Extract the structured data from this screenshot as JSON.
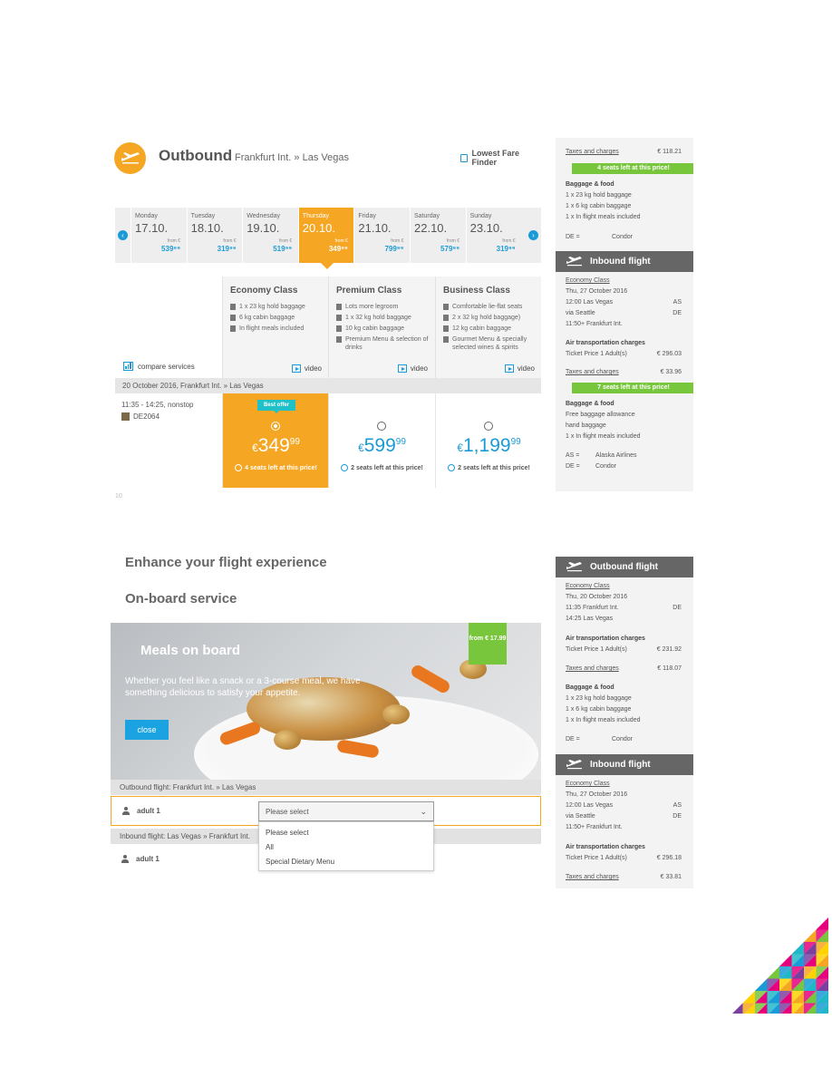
{
  "outbound": {
    "title": "Outbound",
    "route": "Frankfurt Int. » Las Vegas",
    "lowest_fare_finder": "Lowest Fare Finder",
    "days": [
      {
        "name": "Monday",
        "date": "17.10.",
        "from": "from €",
        "price": "539⁹⁹",
        "selected": false
      },
      {
        "name": "Tuesday",
        "date": "18.10.",
        "from": "from €",
        "price": "319⁹⁹",
        "selected": false
      },
      {
        "name": "Wednesday",
        "date": "19.10.",
        "from": "from €",
        "price": "519⁹⁹",
        "selected": false
      },
      {
        "name": "Thursday",
        "date": "20.10.",
        "from": "from €",
        "price": "349⁹⁹",
        "selected": true
      },
      {
        "name": "Friday",
        "date": "21.10.",
        "from": "from €",
        "price": "799⁹⁹",
        "selected": false
      },
      {
        "name": "Saturday",
        "date": "22.10.",
        "from": "from €",
        "price": "579⁹⁹",
        "selected": false
      },
      {
        "name": "Sunday",
        "date": "23.10.",
        "from": "from €",
        "price": "319⁹⁹",
        "selected": false
      }
    ],
    "classes": [
      {
        "title": "Economy Class",
        "features": [
          "1 x 23 kg hold baggage",
          "6 kg cabin baggage",
          "In flight meals included"
        ],
        "video": "video"
      },
      {
        "title": "Premium Class",
        "features": [
          "Lots more legroom",
          "1 x 32 kg hold baggage",
          "10 kg cabin baggage",
          "Premium Menu & selection of drinks"
        ],
        "video": "video"
      },
      {
        "title": "Business Class",
        "features": [
          "Comfortable lie-flat seats",
          "2 x 32 kg hold baggage)",
          "12 kg cabin baggage",
          "Gourmet Menu & specially selected wines & spirits"
        ],
        "video": "video"
      }
    ],
    "compare_services": "compare services",
    "route_bar": "20 October 2016, Frankfurt Int. » Las Vegas",
    "flight_time": "11:35 - 14:25, nonstop",
    "flight_no": "DE2064",
    "best_offer": "Best offer",
    "fares": [
      {
        "currency": "€",
        "main": "349",
        "cents": "99",
        "seats": "4 seats left at this price!",
        "best": true
      },
      {
        "currency": "€",
        "main": "599",
        "cents": "99",
        "seats": "2 seats left at this price!",
        "best": false
      },
      {
        "currency": "€",
        "main": "1,199",
        "cents": "99",
        "seats": "2 seats left at this price!",
        "best": false
      }
    ],
    "page_number": "10"
  },
  "sidebar_top": {
    "taxes_label": "Taxes and charges",
    "taxes_value": "€ 118.21",
    "seats_band1": "4 seats left at this price!",
    "baggage_title": "Baggage & food",
    "baggage_items": [
      "1 x 23 kg hold baggage",
      "1 x 6 kg cabin baggage",
      "1 x In flight meals included"
    ],
    "carrier_code": "DE =",
    "carrier_name": "Condor",
    "inbound_title": "Inbound flight",
    "class": "Economy Class",
    "date": "Thu, 27 October 2016",
    "dep": "12:00 Las Vegas",
    "dep_code": "AS",
    "via": "via Seattle",
    "via_code": "DE",
    "arr": "11:50+ Frankfurt Int.",
    "air_charges_title": "Air transportation charges",
    "ticket_label": "Ticket Price 1 Adult(s)",
    "ticket_value": "€ 296.03",
    "taxes2_label": "Taxes and charges",
    "taxes2_value": "€ 33.96",
    "seats_band2": "7 seats left at this price!",
    "baggage2_title": "Baggage & food",
    "baggage2_items": [
      "Free baggage allowance",
      "hand baggage",
      "1 x In flight meals included"
    ],
    "carrier2_code": "AS =",
    "carrier2_name": "Alaska Airlines",
    "carrier3_code": "DE =",
    "carrier3_name": "Condor"
  },
  "enhance": {
    "title": "Enhance your flight experience",
    "subtitle": "On-board service",
    "meal_title": "Meals on board",
    "meal_desc": "Whether you feel like a snack or a 3-course meal, we have something delicious to satisfy your appetite.",
    "close": "close",
    "from_price": "from € 17.99",
    "outbound_label": "Outbound flight: Frankfurt Int. » Las Vegas",
    "inbound_label": "Inbound flight: Las Vegas » Frankfurt Int.",
    "pax1": "adult 1",
    "pax2": "adult 1",
    "select_value": "Please select",
    "options": [
      "Please select",
      "All",
      "Special Dietary Menu"
    ]
  },
  "sidebar_bottom": {
    "outbound_title": "Outbound flight",
    "class": "Economy Class",
    "date": "Thu, 20 October 2016",
    "dep": "11:35 Frankfurt Int.",
    "dep_code": "DE",
    "arr": "14:25 Las Vegas",
    "air_charges_title": "Air transportation charges",
    "ticket_label": "Ticket Price 1 Adult(s)",
    "ticket_value": "€ 231.92",
    "taxes_label": "Taxes and charges",
    "taxes_value": "€ 118.07",
    "baggage_title": "Baggage & food",
    "baggage_items": [
      "1 x 23 kg hold baggage",
      "1 x 6 kg cabin baggage",
      "1 x In flight meals included"
    ],
    "carrier_code": "DE =",
    "carrier_name": "Condor",
    "inbound_title": "Inbound flight",
    "in_class": "Economy Class",
    "in_date": "Thu, 27 October 2016",
    "in_dep": "12:00 Las Vegas",
    "in_dep_code": "AS",
    "in_via": "via Seattle",
    "in_via_code": "DE",
    "in_arr": "11:50+ Frankfurt Int.",
    "in_air_charges_title": "Air transportation charges",
    "in_ticket_label": "Ticket Price 1 Adult(s)",
    "in_ticket_value": "€ 296.18",
    "in_taxes_label": "Taxes and charges",
    "in_taxes_value": "€ 33.81"
  },
  "colors": {
    "accent_orange": "#f5a623",
    "accent_blue": "#1a9ad6",
    "accent_green": "#78c63c",
    "header_grey": "#666666"
  }
}
